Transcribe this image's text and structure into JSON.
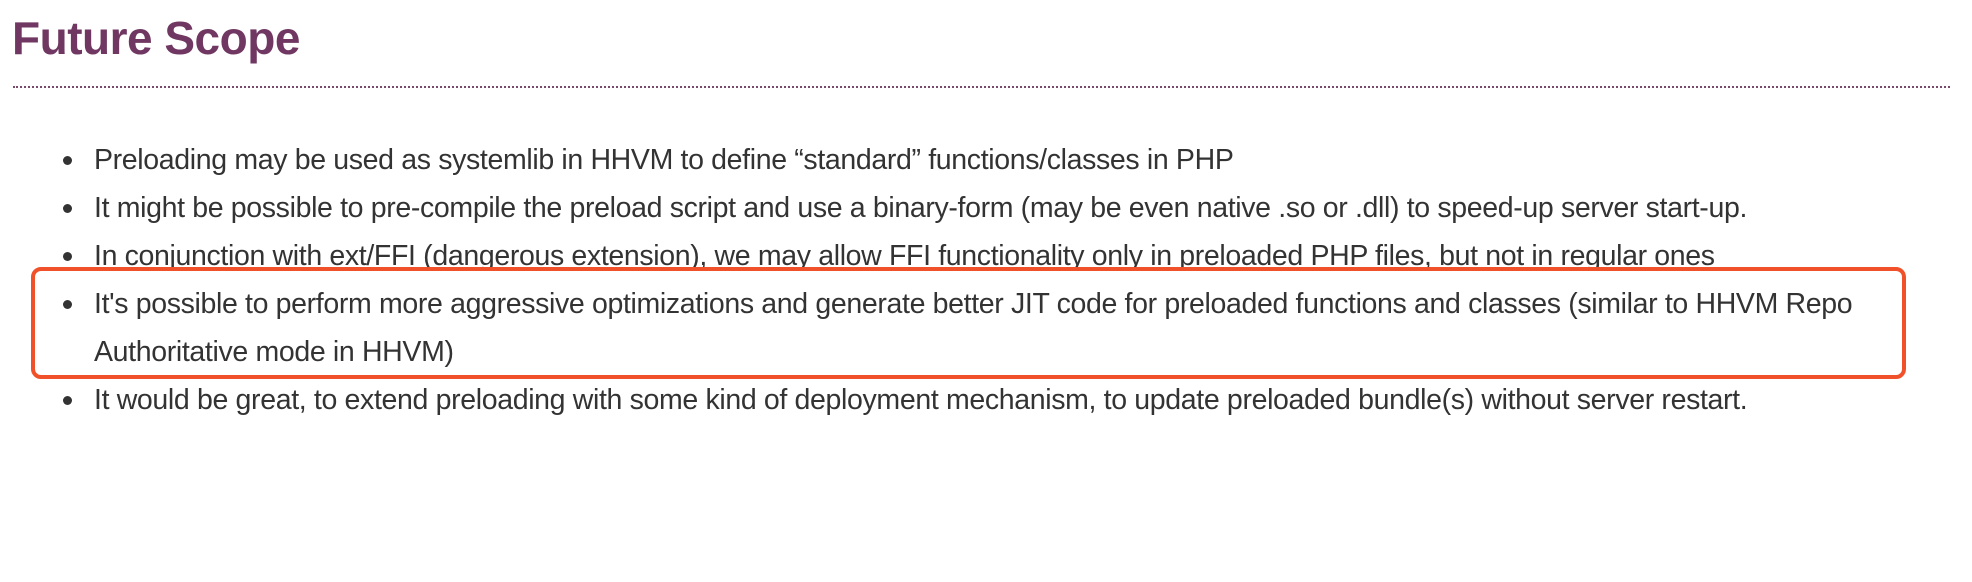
{
  "heading": "Future Scope",
  "items": [
    "Preloading may be used as systemlib in HHVM to define “standard” functions/classes in PHP",
    "It might be possible to pre-compile the preload script and use a binary-form (may be even native .so or .dll) to speed-up server start-up.",
    "In conjunction with ext/FFI (dangerous extension), we may allow FFI functionality only in preloaded PHP files, but not in regular ones",
    "It's possible to perform more aggressive optimizations and generate better JIT code for preloaded functions and classes (similar to HHVM Repo Authoritative mode in HHVM)",
    "It would be great, to extend preloading with some kind of deployment mechanism, to update preloaded bundle(s) without server restart."
  ],
  "highlight": {
    "item_index": 2,
    "color": "#f0512a"
  },
  "colors": {
    "heading": "#6f3761",
    "text": "#333333"
  }
}
